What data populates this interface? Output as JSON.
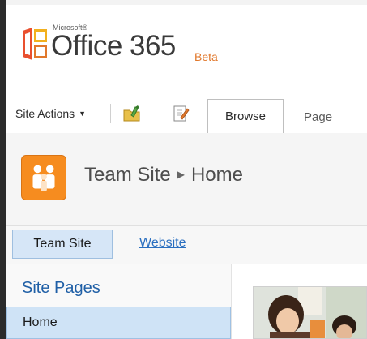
{
  "logo": {
    "microsoft": "Microsoft®",
    "product": "Office 365",
    "beta": "Beta",
    "colors": {
      "orange": "#e1782c",
      "red": "#d9412b",
      "yellow": "#f2b01e"
    }
  },
  "ribbon": {
    "site_actions": "Site Actions",
    "icons": [
      "edit-page-icon",
      "page-properties-icon"
    ],
    "tabs": [
      {
        "label": "Browse",
        "selected": true
      },
      {
        "label": "Page",
        "selected": false
      }
    ]
  },
  "title_area": {
    "icon": "team-site-icon",
    "site": "Team Site",
    "page": "Home"
  },
  "top_nav": {
    "items": [
      {
        "label": "Team Site",
        "selected": true
      },
      {
        "label": "Website",
        "selected": false
      }
    ]
  },
  "quick_launch": {
    "heading": "Site Pages",
    "items": [
      {
        "label": "Home",
        "selected": true
      }
    ]
  },
  "colors": {
    "accent_orange": "#f68c1f",
    "link_blue": "#2a6fc0",
    "selected_blue": "#cfe3f6"
  }
}
